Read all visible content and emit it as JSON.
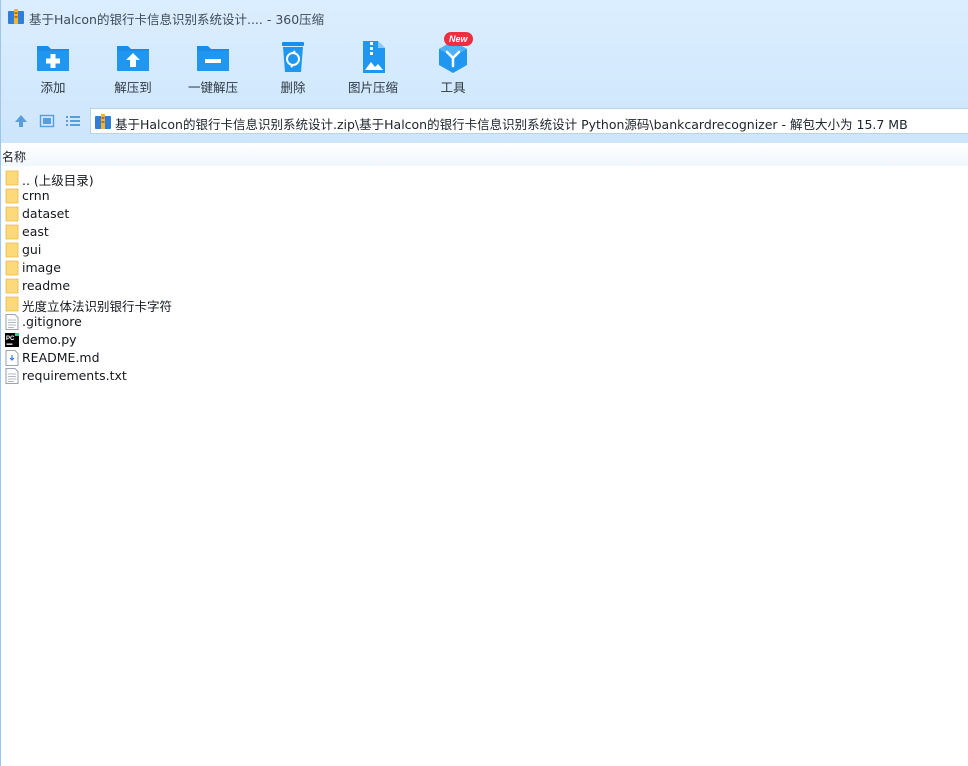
{
  "window": {
    "title": "基于Halcon的银行卡信息识别系统设计.... - 360压缩"
  },
  "toolbar": {
    "items": [
      {
        "label": "添加",
        "icon": "add-folder-icon"
      },
      {
        "label": "解压到",
        "icon": "extract-to-icon"
      },
      {
        "label": "一键解压",
        "icon": "one-click-extract-icon"
      },
      {
        "label": "删除",
        "icon": "trash-icon"
      },
      {
        "label": "图片压缩",
        "icon": "image-compress-icon"
      },
      {
        "label": "工具",
        "icon": "tools-icon",
        "badge": "New"
      }
    ]
  },
  "nav": {
    "buttons": [
      "up-arrow-icon",
      "thumbnail-view-icon",
      "list-view-icon"
    ]
  },
  "address": {
    "path": "基于Halcon的银行卡信息识别系统设计.zip\\基于Halcon的银行卡信息识别系统设计 Python源码\\bankcardrecognizer - 解包大小为 15.7 MB"
  },
  "list": {
    "column_name": "名称",
    "rows": [
      {
        "name": ".. (上级目录)",
        "type": "folder"
      },
      {
        "name": "crnn",
        "type": "folder"
      },
      {
        "name": "dataset",
        "type": "folder"
      },
      {
        "name": "east",
        "type": "folder"
      },
      {
        "name": "gui",
        "type": "folder"
      },
      {
        "name": "image",
        "type": "folder"
      },
      {
        "name": "readme",
        "type": "folder"
      },
      {
        "name": "光度立体法识别银行卡字符",
        "type": "folder"
      },
      {
        "name": ".gitignore",
        "type": "text"
      },
      {
        "name": "demo.py",
        "type": "python"
      },
      {
        "name": "README.md",
        "type": "markdown"
      },
      {
        "name": "requirements.txt",
        "type": "text"
      }
    ]
  },
  "colors": {
    "chrome_bg": "#d3e9fd",
    "icon_blue": "#1a8de8",
    "folder_yellow": "#fcd97a",
    "badge_red": "#ef2f3f"
  }
}
